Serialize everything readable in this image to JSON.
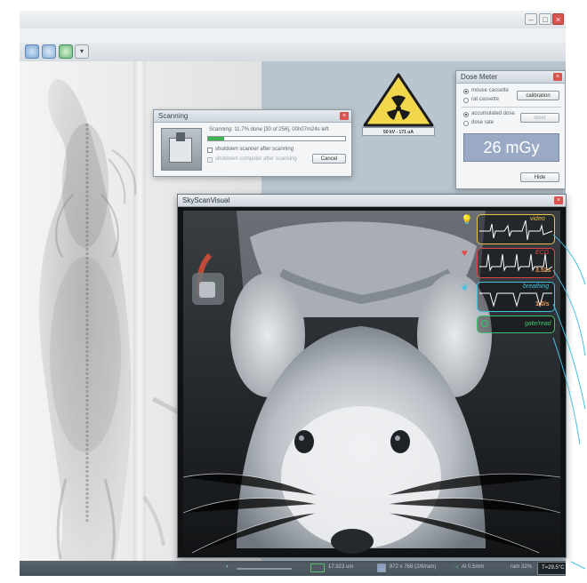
{
  "scan_dialog": {
    "title": "Scanning",
    "progress_text": "Scanning: 11.7% done [30 of 256], 00h07m24s left",
    "progress": 0.117,
    "shutdown_scanner": "shutdown scanner after scanning",
    "shutdown_computer": "shutdown computer after scanning",
    "cancel_label": "Cancel"
  },
  "warning": {
    "label": "50 kV - 171 uA"
  },
  "dose_meter": {
    "title": "Dose Meter",
    "option_mouse": "mouse cassette",
    "option_rat": "rat cassette",
    "calibration_label": "calibration",
    "option_accumulated": "accumulated dose",
    "option_rate": "dose rate",
    "reset_label": "reset",
    "readout": "26 mGy",
    "hide_label": "Hide"
  },
  "viewer": {
    "title": "SkyScanVisual",
    "traces": [
      {
        "label": "video",
        "value": "",
        "color": "#e8c24a"
      },
      {
        "label": "ECG",
        "value": "3.52s",
        "color": "#e04646"
      },
      {
        "label": "breathing",
        "value": "1.0/s",
        "color": "#45c0df"
      },
      {
        "label": "gate/read",
        "value": "",
        "color": "#3fc46a"
      }
    ]
  },
  "statusbar": {
    "pixel_size": "17.923 um",
    "matrix": "972 x 768 (2/8/ram)",
    "filter": "Al 0.5mm",
    "ram": "ram 32%",
    "temperature": "T=29.5°C"
  },
  "colors": {
    "accent": "#45c0df",
    "warning_yellow": "#f2d64b",
    "dose_readout_bg": "#9aaac4"
  }
}
